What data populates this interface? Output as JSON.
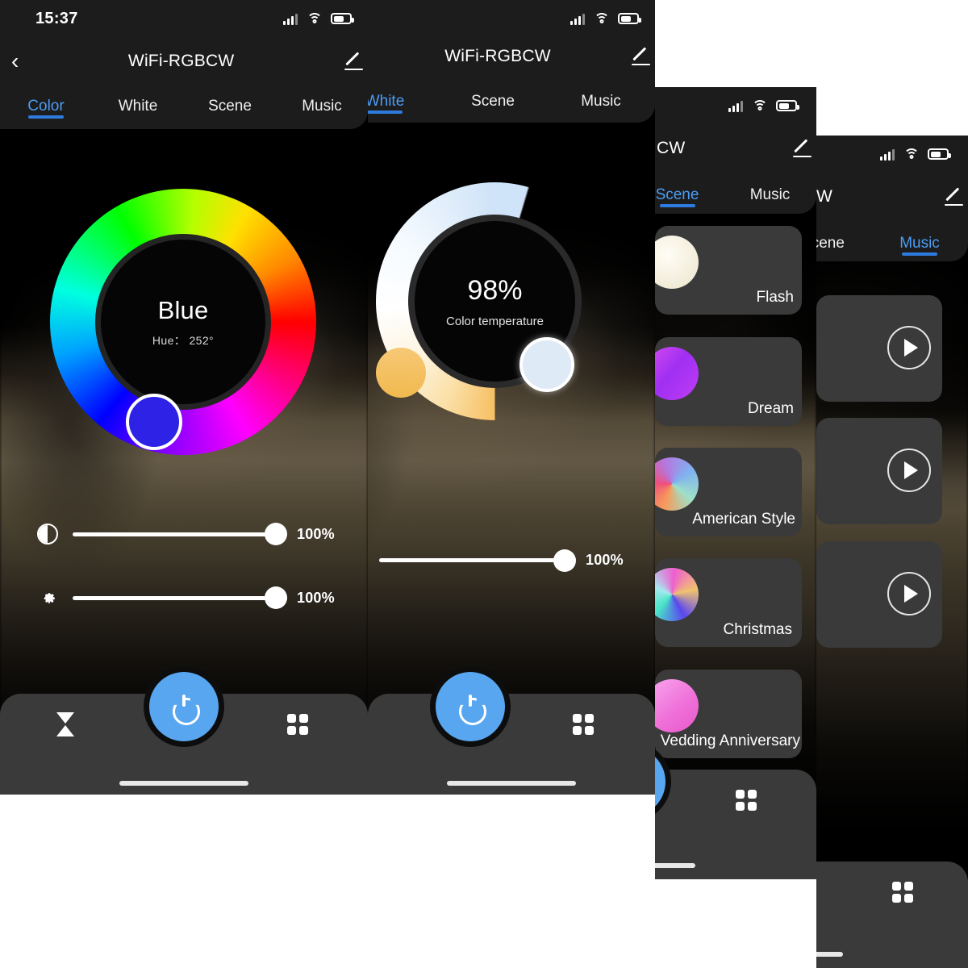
{
  "app": {
    "title": "WiFi-RGBCW",
    "title_clip_3": "CW",
    "title_clip_4": "W",
    "accent": "#4b9cf5",
    "panel_bg": "#1c1c1c",
    "power_color": "#58a6f0"
  },
  "status": {
    "time": "15:37",
    "signal_icon": "signal-bars-icon",
    "wifi_icon": "wifi-icon",
    "battery_icon": "battery-icon"
  },
  "tabs": {
    "all": [
      "Color",
      "White",
      "Scene",
      "Music"
    ],
    "panel1_active": "Color",
    "panel2_active": "White",
    "panel3_active": "Scene",
    "panel4_active": "Music",
    "panel2_visible": [
      "White",
      "Scene",
      "Music"
    ],
    "panel3_visible": [
      "Scene",
      "Music"
    ],
    "panel4_visible": [
      "ene",
      "Music"
    ]
  },
  "color_tab": {
    "wheel_name": "Blue",
    "wheel_hue_label": "Hue： 252°",
    "hue_degrees": 252,
    "knob_color": "#2e22e6",
    "sliders": [
      {
        "icon": "contrast-icon",
        "value": "100%",
        "percent": 100
      },
      {
        "icon": "brightness-icon",
        "value": "100%",
        "percent": 100
      }
    ]
  },
  "white_tab": {
    "value": "98%",
    "label": "Color temperature",
    "percent": 98,
    "slider": {
      "value": "100%",
      "percent": 100
    }
  },
  "scene_tab": {
    "items": [
      {
        "label": "Flash",
        "colors": [
          "#fdfaf0",
          "#efe8cf"
        ]
      },
      {
        "label": "Dream",
        "colors": [
          "#c531f0",
          "#8c2ef5"
        ]
      },
      {
        "label": "American Style",
        "colors": [
          "#f79a5a",
          "#ef4f7d",
          "#7fb2f0"
        ]
      },
      {
        "label": "Christmas",
        "colors": [
          "#5a47f0",
          "#49e6c8",
          "#ef5fd0"
        ]
      },
      {
        "label": "Wedding Anniversary",
        "colors": [
          "#f58fe8",
          "#ef6fd8"
        ]
      }
    ],
    "last_label_clipped": "Vedding Anniversary"
  },
  "music_tab": {
    "cards": [
      {
        "icon": "play-icon"
      },
      {
        "icon": "play-icon"
      },
      {
        "icon": "play-icon"
      }
    ]
  },
  "bottom_bar": {
    "timer_icon": "hourglass-timer-icon",
    "power_icon": "power-icon",
    "grid_icon": "grid-apps-icon"
  }
}
